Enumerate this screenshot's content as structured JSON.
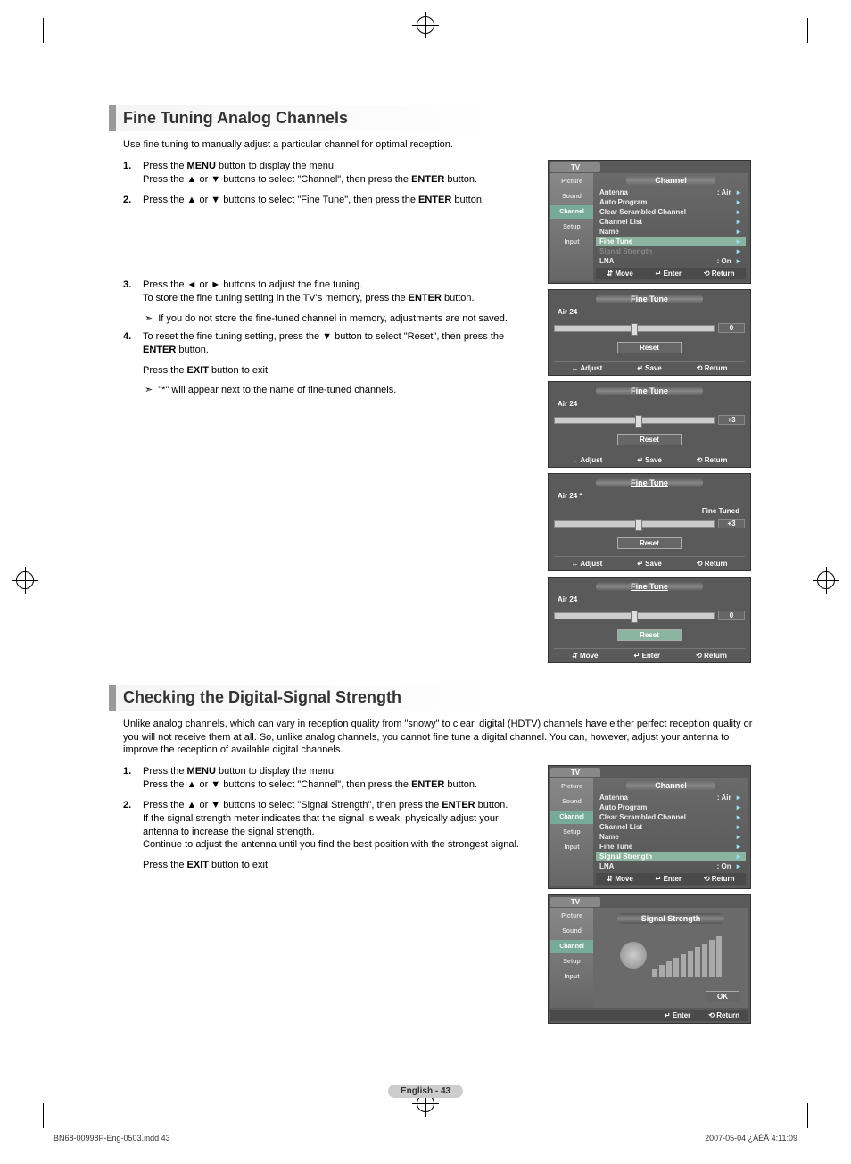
{
  "section1": {
    "title": "Fine Tuning Analog Channels",
    "intro": "Use fine tuning to manually adjust a particular channel for optimal reception.",
    "steps": [
      {
        "n": "1.",
        "html": "Press the <b>MENU</b> button to display the menu.<br>Press the ▲ or ▼ buttons to select \"Channel\", then press the <b>ENTER</b> button."
      },
      {
        "n": "2.",
        "html": "Press the ▲ or ▼ buttons to select \"Fine Tune\", then press the <b>ENTER</b> button."
      },
      {
        "n": "3.",
        "html": "Press the ◄ or ► buttons to adjust the fine tuning.<br>To store the fine tuning setting in the TV's memory, press the <b>ENTER</b> button."
      },
      {
        "n": "4.",
        "html": "To reset the fine tuning setting, press the ▼ button to select \"Reset\", then press  the <b>ENTER</b> button."
      }
    ],
    "note1": "If you do not store the fine-tuned channel in memory, adjustments are not saved.",
    "exit": "Press the <b>EXIT</b> button to exit.",
    "note2": "\"*\" will appear next to the name of fine-tuned channels."
  },
  "section2": {
    "title": "Checking the Digital-Signal Strength",
    "intro": "Unlike analog channels, which can vary in reception quality from \"snowy\" to clear, digital (HDTV) channels have either perfect reception quality or you will not receive them at all. So, unlike analog channels, you cannot fine tune a digital channel. You can, however, adjust your antenna to improve the reception of available digital channels.",
    "steps": [
      {
        "n": "1.",
        "html": "Press the <b>MENU</b> button to display the menu.<br>Press the ▲ or ▼ buttons to select \"Channel\", then press the <b>ENTER</b> button."
      },
      {
        "n": "2.",
        "html": "Press the ▲ or ▼ buttons to select \"Signal Strength\", then press the <b>ENTER</b> button.<br>If the signal strength meter indicates that the signal is weak, physically adjust your antenna to increase the signal strength.<br>Continue to adjust the antenna until you find the best position with the strongest signal."
      }
    ],
    "exit": "Press the <b>EXIT</b> button to exit"
  },
  "osd": {
    "tv": "TV",
    "sidebar": [
      "Picture",
      "Sound",
      "Channel",
      "Setup",
      "Input"
    ],
    "channel_title": "Channel",
    "rows": [
      {
        "l": "Antenna",
        "r": ": Air"
      },
      {
        "l": "Auto Program",
        "r": ""
      },
      {
        "l": "Clear Scrambled Channel",
        "r": ""
      },
      {
        "l": "Channel List",
        "r": ""
      },
      {
        "l": "Name",
        "r": ""
      },
      {
        "l": "Fine Tune",
        "r": ""
      },
      {
        "l": "Signal Strength",
        "r": ""
      },
      {
        "l": "LNA",
        "r": ": On"
      }
    ],
    "footer": {
      "move": "Move",
      "enter": "Enter",
      "return": "Return",
      "adjust": "Adjust",
      "save": "Save"
    }
  },
  "ft": {
    "title": "Fine Tune",
    "ch": "Air 24",
    "ch_star": "Air 24  *",
    "reset": "Reset",
    "fine_tuned": "Fine Tuned",
    "v0": "0",
    "v3": "+3"
  },
  "ss": {
    "title": "Signal Strength",
    "ok": "OK"
  },
  "pagefoot": "English - 43",
  "doc_footer_left": "BN68-00998P-Eng-0503.indd   43",
  "doc_footer_right": "2007-05-04   ¿ÀÈÄ 4:11:09"
}
